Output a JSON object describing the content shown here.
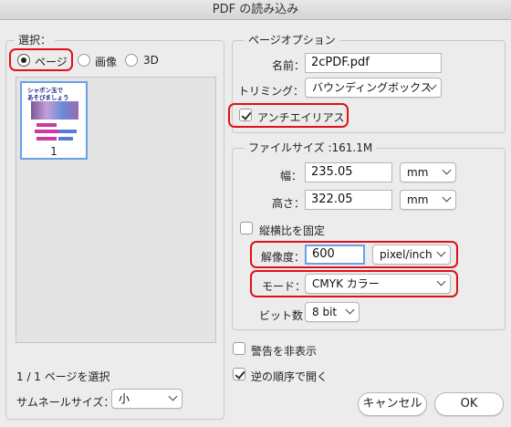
{
  "window": {
    "title": "PDF の読み込み"
  },
  "select_section": {
    "legend": "選択：",
    "options": [
      {
        "label": "ページ",
        "checked": true
      },
      {
        "label": "画像",
        "checked": false
      },
      {
        "label": "3D",
        "checked": false
      }
    ],
    "thumbnail": {
      "page_number": "1",
      "heading_line1": "シャボン玉で",
      "heading_line2": "あそびましょう"
    },
    "selection_status": "1 / 1 ページを選択",
    "thumb_size_label": "サムネールサイズ：",
    "thumb_size_value": "小"
  },
  "page_options": {
    "legend": "ページオプション",
    "name_label": "名前：",
    "name_value": "2cPDF.pdf",
    "crop_label": "トリミング：",
    "crop_value": "バウンディングボックス",
    "antialias_label": "アンチエイリアス",
    "antialias_checked": true
  },
  "file_size": {
    "legend": "ファイルサイズ :161.1M",
    "width_label": "幅：",
    "width_value": "235.05",
    "width_unit": "mm",
    "height_label": "高さ：",
    "height_value": "322.05",
    "height_unit": "mm",
    "constrain_label": "縦横比を固定",
    "constrain_checked": false,
    "resolution_label": "解像度：",
    "resolution_value": "600",
    "resolution_unit": "pixel/inch",
    "mode_label": "モード：",
    "mode_value": "CMYK カラー",
    "bitdepth_label": "ビット数：",
    "bitdepth_value": "8 bit"
  },
  "options": {
    "suppress_warnings_label": "警告を非表示",
    "suppress_warnings_checked": false,
    "reverse_order_label": "逆の順序で開く",
    "reverse_order_checked": true
  },
  "buttons": {
    "cancel": "キャンセル",
    "ok": "OK"
  }
}
